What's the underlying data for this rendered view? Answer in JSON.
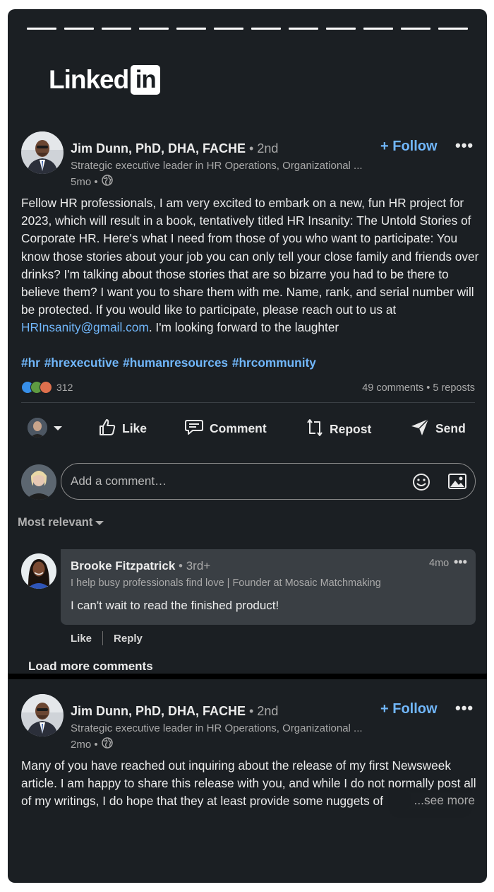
{
  "brand": {
    "logo_text": "Linked",
    "logo_box": "in"
  },
  "post1": {
    "author": "Jim Dunn, PhD, DHA, FACHE",
    "degree": "• 2nd",
    "headline": "Strategic executive leader in HR Operations, Organizational ...",
    "time": "5mo •",
    "follow_label": "+ Follow",
    "more_label": "•••",
    "body_pre": "Fellow HR professionals, I am very excited to embark on a new, fun HR project for 2023, which will result in a book, tentatively titled HR Insanity: The Untold Stories of Corporate HR. Here's what I need from those of you who want to participate: You know those stories about your job you can only tell your close family and friends over drinks? I'm talking about those stories that are so bizarre you had to be there to believe them? I want you to share them with me. Name, rank, and serial number will be protected. If you would like to participate, please reach out to us at ",
    "body_link": "HRInsanity@gmail.com",
    "body_post": ". I'm looking forward to the laughter",
    "hashtags": "#hr #hrexecutive #humanresources #hrcommunity",
    "reaction_count": "312",
    "counts": "49 comments • 5 reposts",
    "actions": {
      "like": "Like",
      "comment": "Comment",
      "repost": "Repost",
      "send": "Send"
    },
    "comment_placeholder": "Add a comment…",
    "sort_label": "Most relevant",
    "comment": {
      "author": "Brooke Fitzpatrick",
      "degree": "• 3rd+",
      "headline": "I help busy professionals find love | Founder at Mosaic Matchmaking",
      "text": "I can't wait to read the finished product!",
      "time": "4mo",
      "more_label": "•••",
      "like": "Like",
      "reply": "Reply"
    },
    "load_more": "Load more comments"
  },
  "post2": {
    "author": "Jim Dunn, PhD, DHA, FACHE",
    "degree": "• 2nd",
    "headline": "Strategic executive leader in HR Operations, Organizational ...",
    "time": "2mo •",
    "follow_label": "+ Follow",
    "more_label": "•••",
    "body": "Many of you have reached out inquiring about the release of my first Newsweek article. I am happy to share this release with you, and while I do not normally post all of my writings, I do hope that they at least provide some nuggets of",
    "see_more": "...see more"
  },
  "colors": {
    "background": "#1b1f23",
    "accent": "#71b7fb",
    "bubble": "#3a3f44"
  }
}
